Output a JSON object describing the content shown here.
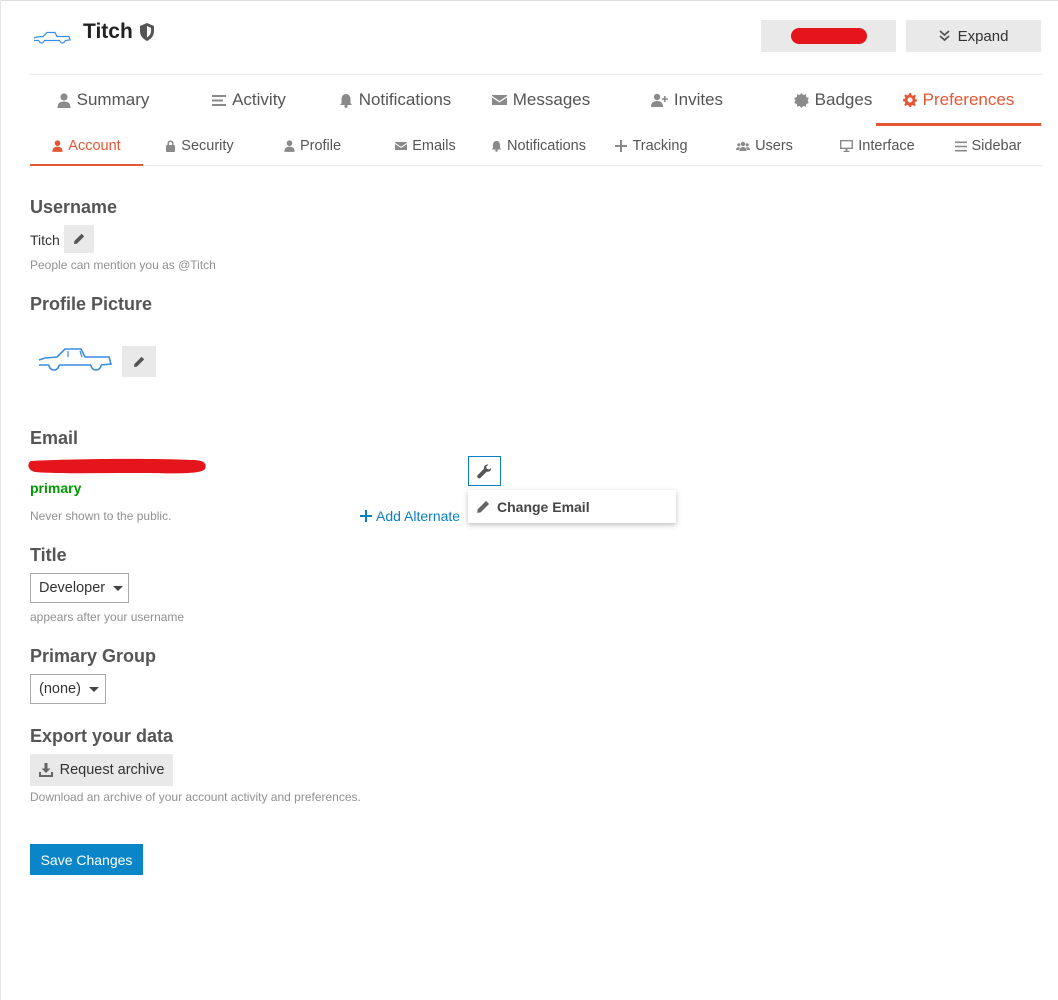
{
  "user": {
    "name": "Titch"
  },
  "header": {
    "expand_label": "Expand"
  },
  "primary_nav": [
    {
      "label": "Summary",
      "icon": "user-icon"
    },
    {
      "label": "Activity",
      "icon": "list-icon"
    },
    {
      "label": "Notifications",
      "icon": "bell-icon"
    },
    {
      "label": "Messages",
      "icon": "envelope-icon"
    },
    {
      "label": "Invites",
      "icon": "user-plus-icon"
    },
    {
      "label": "Badges",
      "icon": "certificate-icon"
    },
    {
      "label": "Preferences",
      "icon": "cog-icon",
      "active": true
    }
  ],
  "secondary_nav": [
    {
      "label": "Account",
      "icon": "user-icon",
      "active": true
    },
    {
      "label": "Security",
      "icon": "lock-icon"
    },
    {
      "label": "Profile",
      "icon": "user-icon"
    },
    {
      "label": "Emails",
      "icon": "envelope-icon"
    },
    {
      "label": "Notifications",
      "icon": "bell-icon"
    },
    {
      "label": "Tracking",
      "icon": "plus-icon"
    },
    {
      "label": "Users",
      "icon": "users-icon"
    },
    {
      "label": "Interface",
      "icon": "desktop-icon"
    },
    {
      "label": "Sidebar",
      "icon": "bars-icon"
    }
  ],
  "username_section": {
    "title": "Username",
    "value": "Titch",
    "help": "People can mention you as @Titch"
  },
  "profile_picture": {
    "title": "Profile Picture"
  },
  "email_section": {
    "title": "Email",
    "primary_label": "primary",
    "help": "Never shown to the public.",
    "add_alternate": "Add Alternate",
    "menu_item": "Change Email"
  },
  "title_section": {
    "title": "Title",
    "selected": "Developer",
    "help": "appears after your username"
  },
  "primary_group": {
    "title": "Primary Group",
    "selected": "(none)"
  },
  "export": {
    "title": "Export your data",
    "button": "Request archive",
    "help": "Download an archive of your account activity and preferences."
  },
  "save_button": "Save Changes",
  "colors": {
    "accent": "#e45735",
    "link": "#0a7fc3",
    "primary_btn": "#0a86c8",
    "success": "#009900",
    "redaction": "#e5161b"
  }
}
